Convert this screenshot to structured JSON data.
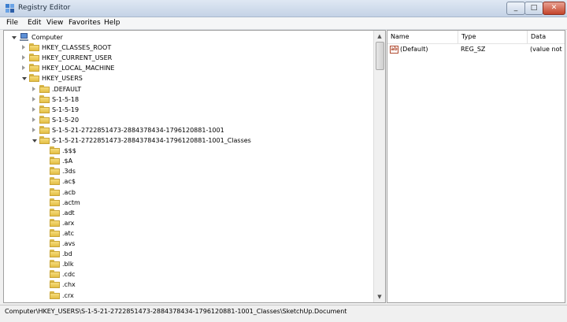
{
  "window": {
    "title": "Registry Editor"
  },
  "menu": [
    "File",
    "Edit",
    "View",
    "Favorites",
    "Help"
  ],
  "tree": [
    {
      "label": "Computer",
      "level": 0,
      "state": "expanded",
      "icon": "computer-icon"
    },
    {
      "label": "HKEY_CLASSES_ROOT",
      "level": 1,
      "state": "collapsed",
      "icon": "folder-icon"
    },
    {
      "label": "HKEY_CURRENT_USER",
      "level": 1,
      "state": "collapsed",
      "icon": "folder-icon"
    },
    {
      "label": "HKEY_LOCAL_MACHINE",
      "level": 1,
      "state": "collapsed",
      "icon": "folder-icon"
    },
    {
      "label": "HKEY_USERS",
      "level": 1,
      "state": "expanded",
      "icon": "folder-icon"
    },
    {
      "label": ".DEFAULT",
      "level": 2,
      "state": "collapsed",
      "icon": "folder-icon"
    },
    {
      "label": "S-1-5-18",
      "level": 2,
      "state": "collapsed",
      "icon": "folder-icon"
    },
    {
      "label": "S-1-5-19",
      "level": 2,
      "state": "collapsed",
      "icon": "folder-icon"
    },
    {
      "label": "S-1-5-20",
      "level": 2,
      "state": "collapsed",
      "icon": "folder-icon"
    },
    {
      "label": "S-1-5-21-2722851473-2884378434-1796120881-1001",
      "level": 2,
      "state": "collapsed",
      "icon": "folder-icon"
    },
    {
      "label": "S-1-5-21-2722851473-2884378434-1796120881-1001_Classes",
      "level": 2,
      "state": "expanded",
      "icon": "folder-icon"
    },
    {
      "label": ".$$$",
      "level": 3,
      "state": "none",
      "icon": "folder-icon"
    },
    {
      "label": ".$A",
      "level": 3,
      "state": "none",
      "icon": "folder-icon"
    },
    {
      "label": ".3ds",
      "level": 3,
      "state": "none",
      "icon": "folder-icon"
    },
    {
      "label": ".ac$",
      "level": 3,
      "state": "none",
      "icon": "folder-icon"
    },
    {
      "label": ".acb",
      "level": 3,
      "state": "none",
      "icon": "folder-icon"
    },
    {
      "label": ".actm",
      "level": 3,
      "state": "none",
      "icon": "folder-icon"
    },
    {
      "label": ".adt",
      "level": 3,
      "state": "none",
      "icon": "folder-icon"
    },
    {
      "label": ".arx",
      "level": 3,
      "state": "none",
      "icon": "folder-icon"
    },
    {
      "label": ".atc",
      "level": 3,
      "state": "none",
      "icon": "folder-icon"
    },
    {
      "label": ".avs",
      "level": 3,
      "state": "none",
      "icon": "folder-icon"
    },
    {
      "label": ".bd",
      "level": 3,
      "state": "none",
      "icon": "folder-icon"
    },
    {
      "label": ".blk",
      "level": 3,
      "state": "none",
      "icon": "folder-icon"
    },
    {
      "label": ".cdc",
      "level": 3,
      "state": "none",
      "icon": "folder-icon"
    },
    {
      "label": ".chx",
      "level": 3,
      "state": "none",
      "icon": "folder-icon"
    },
    {
      "label": ".crx",
      "level": 3,
      "state": "none",
      "icon": "folder-icon"
    }
  ],
  "list": {
    "columns": [
      "Name",
      "Type",
      "Data"
    ],
    "rows": [
      {
        "name": "(Default)",
        "type": "REG_SZ",
        "data": "(value not"
      }
    ]
  },
  "status": "Computer\\HKEY_USERS\\S-1-5-21-2722851473-2884378434-1796120881-1001_Classes\\SketchUp.Document"
}
